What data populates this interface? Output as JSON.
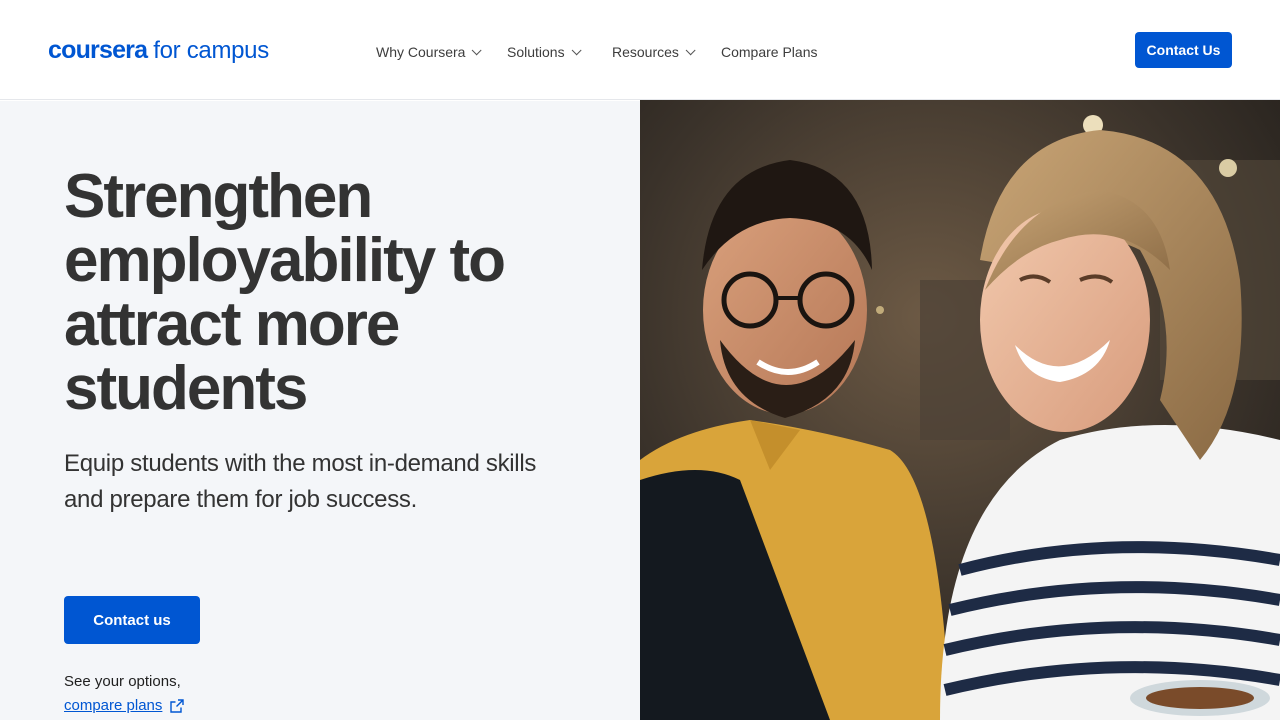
{
  "header": {
    "logo_main": "coursera",
    "logo_sub": "for campus",
    "nav": [
      {
        "label": "Why Coursera",
        "has_dropdown": true
      },
      {
        "label": "Solutions",
        "has_dropdown": true
      },
      {
        "label": "Resources",
        "has_dropdown": true
      },
      {
        "label": "Compare Plans",
        "has_dropdown": false
      }
    ],
    "contact_label": "Contact Us"
  },
  "hero": {
    "headline_lines": [
      "Strengthen",
      "employability to",
      "attract more",
      "students"
    ],
    "subtitle_lines": [
      "Equip students with the most in-demand skills",
      "and prepare them for job success."
    ],
    "cta_label": "Contact us",
    "options_text": "See your options,",
    "compare_link": "compare plans"
  },
  "colors": {
    "brand": "#0056d2",
    "panel_bg": "#f4f6f9",
    "text": "#333333"
  },
  "icons": {
    "external_link": "external-link-icon",
    "dropdown": "chevron-down-icon"
  }
}
